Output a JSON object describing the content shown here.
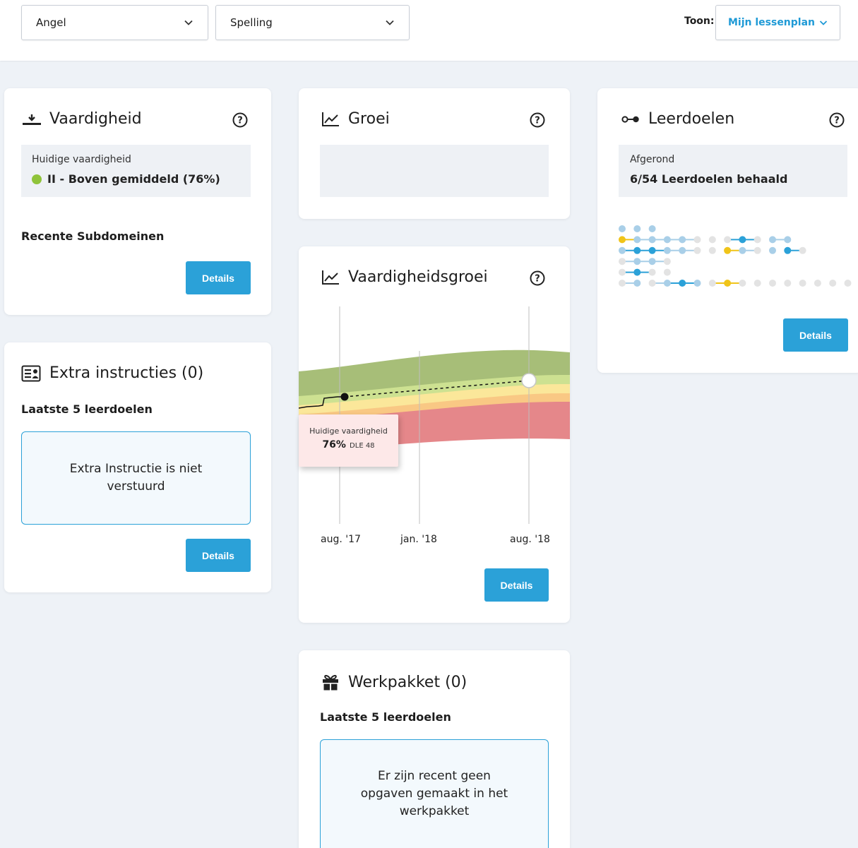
{
  "topbar": {
    "student_select": "Angel",
    "subject_select": "Spelling",
    "show_label": "Toon:",
    "plan_button": "Mijn lessenplan"
  },
  "vaardigheid": {
    "title": "Vaardigheid",
    "current_label": "Huidige vaardigheid",
    "current_value": "II - Boven gemiddeld (76%)",
    "status_color": "#8fc33a",
    "recent_subdomains": "Recente Subdomeinen",
    "details": "Details"
  },
  "groei": {
    "title": "Groei"
  },
  "leerdoelen": {
    "title": "Leerdoelen",
    "completed_label": "Afgerond",
    "completed_value": "6/54 Leerdoelen behaald",
    "details": "Details",
    "rows": [
      [
        "L",
        "L",
        "L"
      ],
      [
        "Y",
        "L",
        "L",
        "L",
        "L",
        "G",
        "G",
        "G",
        "B",
        "G",
        "L",
        "L"
      ],
      [
        "L",
        "B",
        "B",
        "L",
        "L",
        "G",
        "G",
        "Y",
        "L",
        "G",
        "L",
        "B",
        "G"
      ],
      [
        "G",
        "L",
        "L",
        "G"
      ],
      [
        "G",
        "B",
        "G",
        "G"
      ],
      [
        "G",
        "L",
        "G",
        "L",
        "B",
        "L",
        "G",
        "Y",
        "G",
        "G",
        "G",
        "G",
        "G",
        "G",
        "G",
        "G"
      ]
    ],
    "links": [
      [],
      [
        0,
        1,
        2,
        3,
        4,
        7,
        8,
        10
      ],
      [
        0,
        1,
        2,
        3,
        4,
        7,
        8,
        11
      ],
      [
        0,
        1,
        2
      ],
      [
        0,
        1
      ],
      [
        0,
        2,
        3,
        4,
        6,
        7
      ]
    ]
  },
  "extra": {
    "title": "Extra instructies (0)",
    "subhead": "Laatste 5 leerdoelen",
    "empty": "Extra Instructie is niet verstuurd",
    "details": "Details"
  },
  "vgroei": {
    "title": "Vaardigheidsgroei",
    "x_labels": [
      "aug. '17",
      "jan. '18",
      "aug. '18"
    ],
    "tooltip_label": "Huidige vaardigheid",
    "tooltip_value": "76%",
    "tooltip_dle": "DLE 48",
    "details": "Details",
    "colors": {
      "band_top": "#a7be78",
      "band_2": "#cde191",
      "band_3": "#fbe79a",
      "band_4": "#f9c884",
      "band_bottom": "#e5878a"
    }
  },
  "werkpakket": {
    "title": "Werkpakket (0)",
    "subhead": "Laatste 5 leerdoelen",
    "empty": "Er zijn recent geen opgaven gemaakt in het werkpakket"
  }
}
